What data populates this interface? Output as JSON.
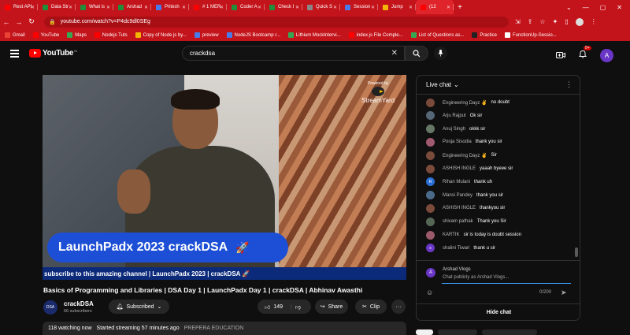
{
  "browser": {
    "tabs": [
      {
        "label": "Rest API",
        "color": "#ff0000"
      },
      {
        "label": "Data Str",
        "color": "#1f8f3a"
      },
      {
        "label": "What is",
        "color": "#1f8f3a"
      },
      {
        "label": "Arshad",
        "color": "#1f8f3a"
      },
      {
        "label": "Pritesh",
        "color": "#4a7bea"
      },
      {
        "label": "# 1 MER",
        "color": "#ff0000"
      },
      {
        "label": "Coder A",
        "color": "#1f8f3a"
      },
      {
        "label": "Check I",
        "color": "#1f8f3a"
      },
      {
        "label": "Quick S",
        "color": "#888888"
      },
      {
        "label": "Session",
        "color": "#4a7bea"
      },
      {
        "label": "Jump",
        "color": "#f2b705"
      },
      {
        "label": "(12",
        "color": "#ff0000"
      }
    ],
    "new_tab_label": "+",
    "url": "youtube.com/watch?v=P4dc9dl0SEg",
    "bookmarks": [
      {
        "label": "Gmail",
        "color": "#ea4335"
      },
      {
        "label": "YouTube",
        "color": "#ff0000"
      },
      {
        "label": "Maps",
        "color": "#34a853"
      },
      {
        "label": "Nodejs Tuts",
        "color": "#ff0000"
      },
      {
        "label": "Copy of Node js by...",
        "color": "#f2b705"
      },
      {
        "label": "preview",
        "color": "#4a7bea"
      },
      {
        "label": "NodeJS Bootcamp r...",
        "color": "#4a7bea"
      },
      {
        "label": "Lithium MockIntervi...",
        "color": "#34a853"
      },
      {
        "label": "index.js File Comple...",
        "color": "#ff0000"
      },
      {
        "label": "List of Questions as...",
        "color": "#34a853"
      },
      {
        "label": "Practice",
        "color": "#222222"
      },
      {
        "label": "FunctionUp-Sessio...",
        "color": "#ffffff"
      }
    ],
    "profile_badge": "A"
  },
  "youtube": {
    "logo_text": "YouTube",
    "logo_region": "IN",
    "search_query": "crackdsa",
    "notification_count": "9+",
    "avatar_letter": "A"
  },
  "video": {
    "overlay_brand_top": "Powered by",
    "overlay_brand": "StreamYard",
    "lower_third": "LaunchPadx 2023 crackDSA",
    "lower_third_emoji": "🚀",
    "ticker": "subscribe to this amazing channel | LaunchPadx 2023 | crackDSA 🚀"
  },
  "meta": {
    "title": "Basics of Programming and Libraries | DSA Day 1 | LaunchPadx Day 1 | crackDSA | Abhinav Awasthi",
    "channel_name": "crackDSA",
    "channel_subs": "66 subscribers",
    "channel_logo_text": "DSA",
    "subscribed_label": "Subscribed",
    "likes": "149",
    "share_label": "Share",
    "clip_label": "Clip",
    "more_label": "···",
    "watching": "118 watching now",
    "started": "Started streaming 57 minutes ago",
    "org": "PREPERA EDUCATION"
  },
  "chat": {
    "header": "Live chat",
    "messages": [
      {
        "name": "Engineering Dayz ✌",
        "text": "no doubt",
        "color": "#7a4a3a",
        "initial": ""
      },
      {
        "name": "Arju Rajput",
        "text": "Ok sir",
        "color": "#556677",
        "initial": ""
      },
      {
        "name": "Anuj Singh",
        "text": "okkk sir",
        "color": "#667766",
        "initial": ""
      },
      {
        "name": "Pooja Sisodia",
        "text": "thank you sir",
        "color": "#a05a70",
        "initial": ""
      },
      {
        "name": "Engineering Dayz ✌",
        "text": "Sir",
        "color": "#7a4a3a",
        "initial": ""
      },
      {
        "name": "ASHISH INGLE",
        "text": "yaaah byeee sir",
        "color": "#7a4a3a",
        "initial": ""
      },
      {
        "name": "Rihan Mulani",
        "text": "thank uh",
        "color": "#2b6fd6",
        "initial": "R"
      },
      {
        "name": "Mansi Pandey",
        "text": "thank you sir",
        "color": "#4a6a8a",
        "initial": ""
      },
      {
        "name": "ASHISH INGLE",
        "text": "thankyou sir",
        "color": "#7a4a3a",
        "initial": ""
      },
      {
        "name": "shivam pathak",
        "text": "Thank you Sir",
        "color": "#556655",
        "initial": ""
      },
      {
        "name": "KARTIK",
        "text": "sir is today is doubt session",
        "color": "#9a5a6a",
        "initial": ""
      },
      {
        "name": "shalini Tiwari",
        "text": "thank u sir",
        "color": "#6a36c7",
        "initial": "s"
      }
    ],
    "composer_name": "Arshad Vlogs",
    "composer_avatar": "A",
    "composer_placeholder": "Chat publicly as Arshad Vlogs...",
    "char_count": "0/200",
    "hide_label": "Hide chat"
  }
}
